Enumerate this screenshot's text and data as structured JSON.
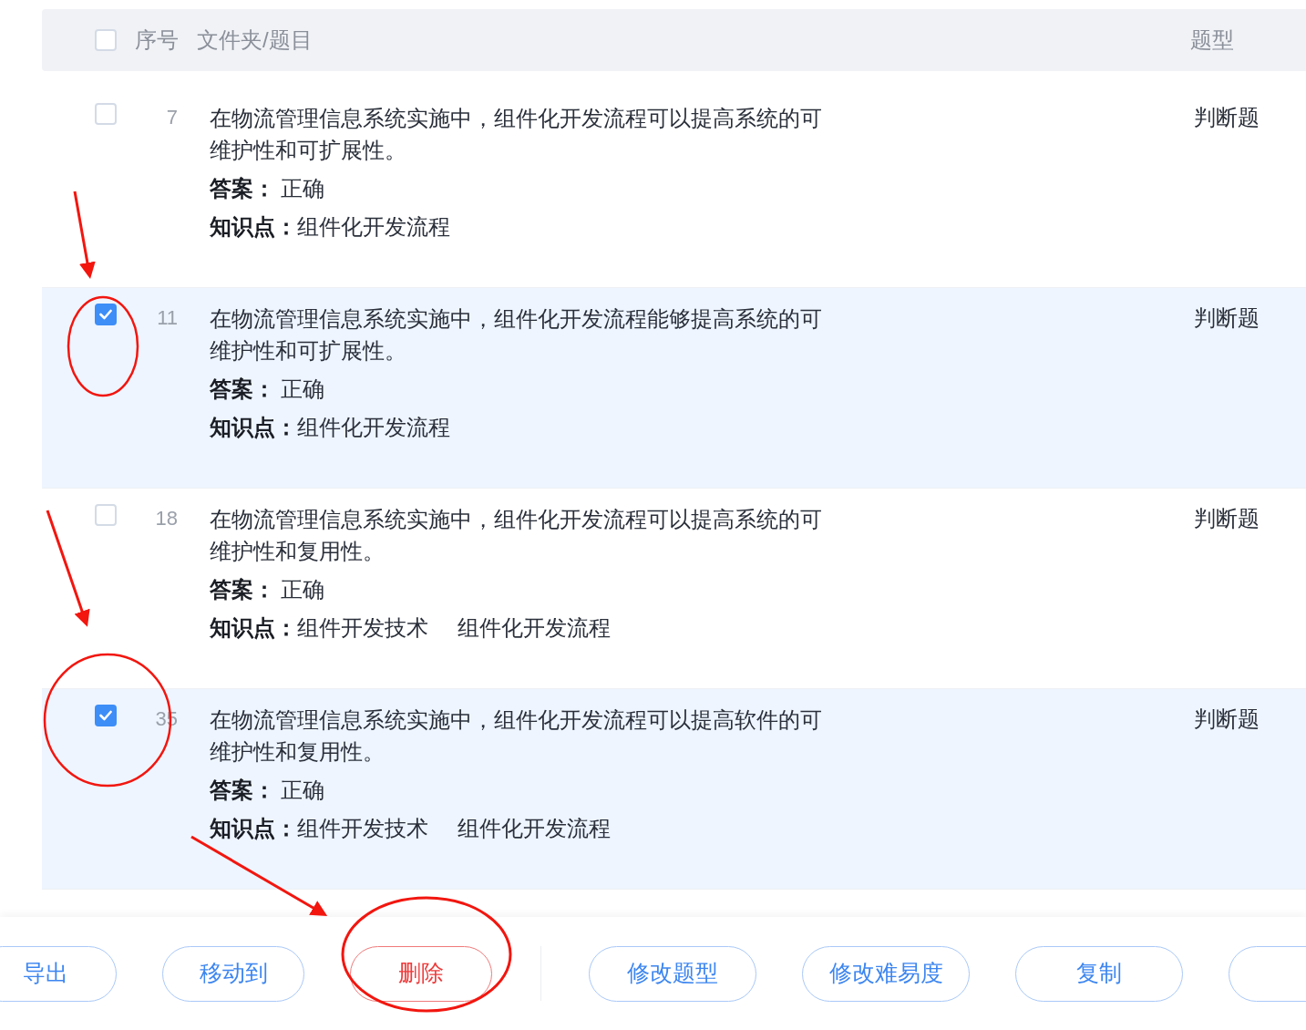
{
  "table": {
    "header": {
      "checked": false,
      "columns": [
        "序号",
        "文件夹/题目",
        "题型"
      ]
    },
    "rows": [
      {
        "selected": false,
        "number": "7",
        "question": "在物流管理信息系统实施中，组件化开发流程可以提高系统的可维护性和可扩展性。",
        "answer_label": "答案：",
        "answer": "正确",
        "knowledge_label": "知识点：",
        "knowledge": [
          "组件化开发流程"
        ],
        "type": "判断题"
      },
      {
        "selected": true,
        "number": "11",
        "question": "在物流管理信息系统实施中，组件化开发流程能够提高系统的可维护性和可扩展性。",
        "answer_label": "答案：",
        "answer": "正确",
        "knowledge_label": "知识点：",
        "knowledge": [
          "组件化开发流程"
        ],
        "type": "判断题"
      },
      {
        "selected": false,
        "number": "18",
        "question": "在物流管理信息系统实施中，组件化开发流程可以提高系统的可维护性和复用性。",
        "answer_label": "答案：",
        "answer": "正确",
        "knowledge_label": "知识点：",
        "knowledge": [
          "组件开发技术",
          "组件化开发流程"
        ],
        "type": "判断题"
      },
      {
        "selected": true,
        "number": "35",
        "question": "在物流管理信息系统实施中，组件化开发流程可以提高软件的可维护性和复用性。",
        "answer_label": "答案：",
        "answer": "正确",
        "knowledge_label": "知识点：",
        "knowledge": [
          "组件开发技术",
          "组件化开发流程"
        ],
        "type": "判断题"
      }
    ]
  },
  "actions": [
    {
      "label": "导出",
      "kind": "normal"
    },
    {
      "label": "移动到",
      "kind": "normal"
    },
    {
      "label": "删除",
      "kind": "danger"
    },
    {
      "kind": "divider"
    },
    {
      "label": "修改题型",
      "kind": "normal"
    },
    {
      "label": "修改难易度",
      "kind": "normal"
    },
    {
      "label": "复制",
      "kind": "normal"
    },
    {
      "kind": "cut"
    }
  ]
}
